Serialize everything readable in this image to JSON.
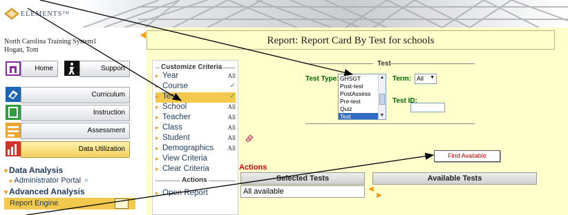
{
  "app": {
    "logo_text": "ELEMENTS™",
    "system_name": "North Carolina Training System1",
    "user_name": "Hogan, Tom"
  },
  "nav": {
    "home_label": "Home",
    "support_label": "Support",
    "buttons": [
      {
        "label": "Curriculum",
        "icon": "curriculum-icon"
      },
      {
        "label": "Instruction",
        "icon": "instruction-icon"
      },
      {
        "label": "Assessment",
        "icon": "assessment-icon"
      },
      {
        "label": "Data Utilization",
        "icon": "data-utilization-icon",
        "active": true
      }
    ],
    "tree": {
      "data_analysis": "Data Analysis",
      "admin_portal": "Administrator Portal",
      "advanced_analysis": "Advanced Analysis",
      "report_engine": "Report Engine"
    }
  },
  "main": {
    "title": "Report: Report Card By Test for schools",
    "customize": {
      "title": "Customize Criteria",
      "rows": [
        {
          "label": "Year",
          "value": "All"
        },
        {
          "label": "Course",
          "check": "✓"
        },
        {
          "label": "Test",
          "check": "✓",
          "selected": true
        },
        {
          "label": "School",
          "value": "All"
        },
        {
          "label": "Teacher",
          "value": "All"
        },
        {
          "label": "Class",
          "value": "All"
        },
        {
          "label": "Student",
          "value": "All"
        },
        {
          "label": "Demographics",
          "value": "All"
        },
        {
          "label": "View Criteria"
        },
        {
          "label": "Clear Criteria"
        }
      ],
      "actions_title": "Actions",
      "open_report": "Open Report"
    },
    "test": {
      "group_title": "Test",
      "type_label": "Test Type:",
      "options": [
        "GHSGT",
        "Post-test",
        "PostAssess",
        "Pre-test",
        "Quiz",
        "Test"
      ],
      "selected_option": "Test",
      "term_label": "Term:",
      "term_value": "All",
      "test_id_label": "Test ID:",
      "test_id_value": ""
    },
    "find_available": "Find Available",
    "actions_label": "Actions",
    "selected_tests_header": "Selected Tests",
    "selected_tests_value": "All available",
    "available_tests_header": "Available Tests"
  },
  "colors": {
    "main_bg": "#ffffcc",
    "highlight": "#f2c94c",
    "accent_orange": "#f39c12",
    "list_selection": "#316ac5"
  }
}
